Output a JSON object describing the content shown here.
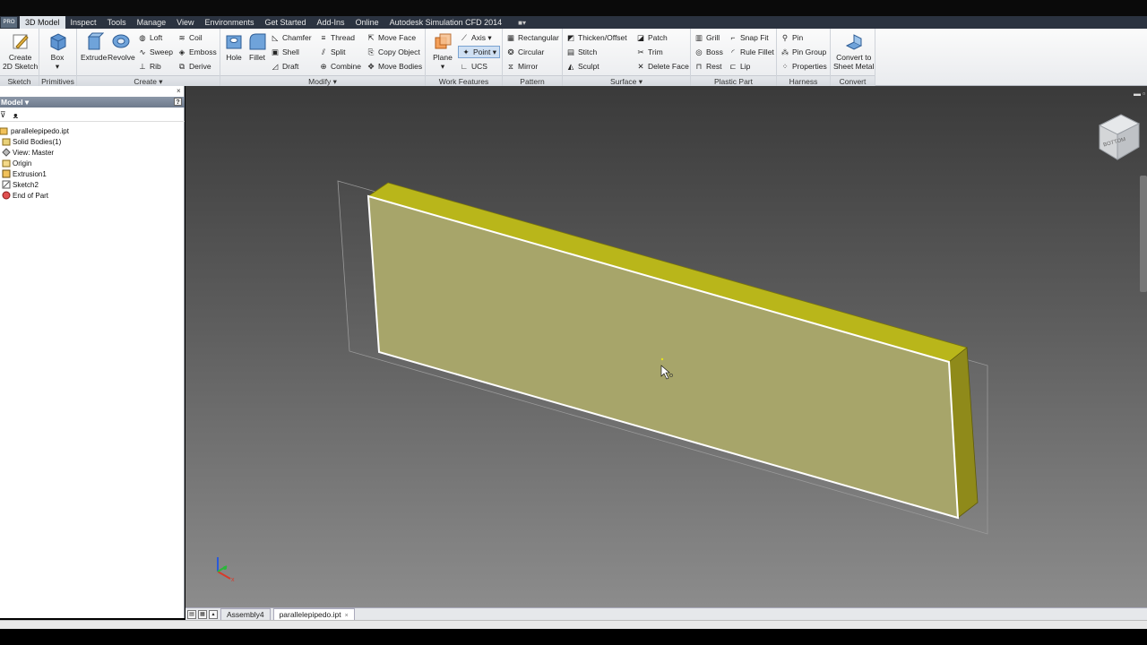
{
  "menu": {
    "app_button": "PRO",
    "tabs": [
      "3D Model",
      "Inspect",
      "Tools",
      "Manage",
      "View",
      "Environments",
      "Get Started",
      "Add-Ins",
      "Online",
      "Autodesk Simulation CFD 2014"
    ],
    "active_tab": "3D Model"
  },
  "ribbon": {
    "panels": {
      "sketch": "Sketch",
      "primitives": "Primitives",
      "create": "Create",
      "modify": "Modify",
      "work_features": "Work Features",
      "pattern": "Pattern",
      "surface": "Surface",
      "plastic_part": "Plastic Part",
      "harness": "Harness",
      "convert": "Convert"
    },
    "sketch": {
      "create_line1": "Create",
      "create_line2": "2D Sketch"
    },
    "primitives": {
      "box": "Box"
    },
    "create": {
      "extrude": "Extrude",
      "revolve": "Revolve",
      "loft": "Loft",
      "sweep": "Sweep",
      "rib": "Rib",
      "coil": "Coil",
      "emboss": "Emboss",
      "derive": "Derive"
    },
    "modify": {
      "hole": "Hole",
      "fillet": "Fillet",
      "chamfer": "Chamfer",
      "shell": "Shell",
      "draft": "Draft",
      "thread": "Thread",
      "split": "Split",
      "combine": "Combine",
      "move_face": "Move Face",
      "copy_object": "Copy Object",
      "move_bodies": "Move Bodies"
    },
    "work_features": {
      "plane": "Plane",
      "axis": "Axis",
      "point": "Point",
      "ucs": "UCS"
    },
    "pattern": {
      "rectangular": "Rectangular",
      "circular": "Circular",
      "mirror": "Mirror"
    },
    "surface": {
      "thicken_offset": "Thicken/Offset",
      "stitch": "Stitch",
      "sculpt": "Sculpt",
      "patch": "Patch",
      "trim": "Trim",
      "delete_face": "Delete Face"
    },
    "plastic_part": {
      "grill": "Grill",
      "boss": "Boss",
      "rest": "Rest",
      "snap_fit": "Snap Fit",
      "rule_fillet": "Rule Fillet",
      "lip": "Lip"
    },
    "harness": {
      "pin": "Pin",
      "pin_group": "Pin Group",
      "properties": "Properties"
    },
    "convert": {
      "line1": "Convert to",
      "line2": "Sheet Metal"
    }
  },
  "browser": {
    "title": "Model",
    "close": "×",
    "help": "?",
    "tree": [
      "parallelepipedo.ipt",
      "Solid Bodies(1)",
      "View: Master",
      "Origin",
      "Extrusion1",
      "Sketch2",
      "End of Part"
    ]
  },
  "viewcube": {
    "face_label": "BOTTOM"
  },
  "doc_tabs": [
    "Assembly4",
    "parallelepipedo.ipt"
  ],
  "doc_tab_close": "×",
  "colors": {
    "solid_front": "#a7a56a",
    "solid_top": "#b9b61a",
    "solid_side": "#8f8a1a",
    "menubar": "#2b3340"
  }
}
